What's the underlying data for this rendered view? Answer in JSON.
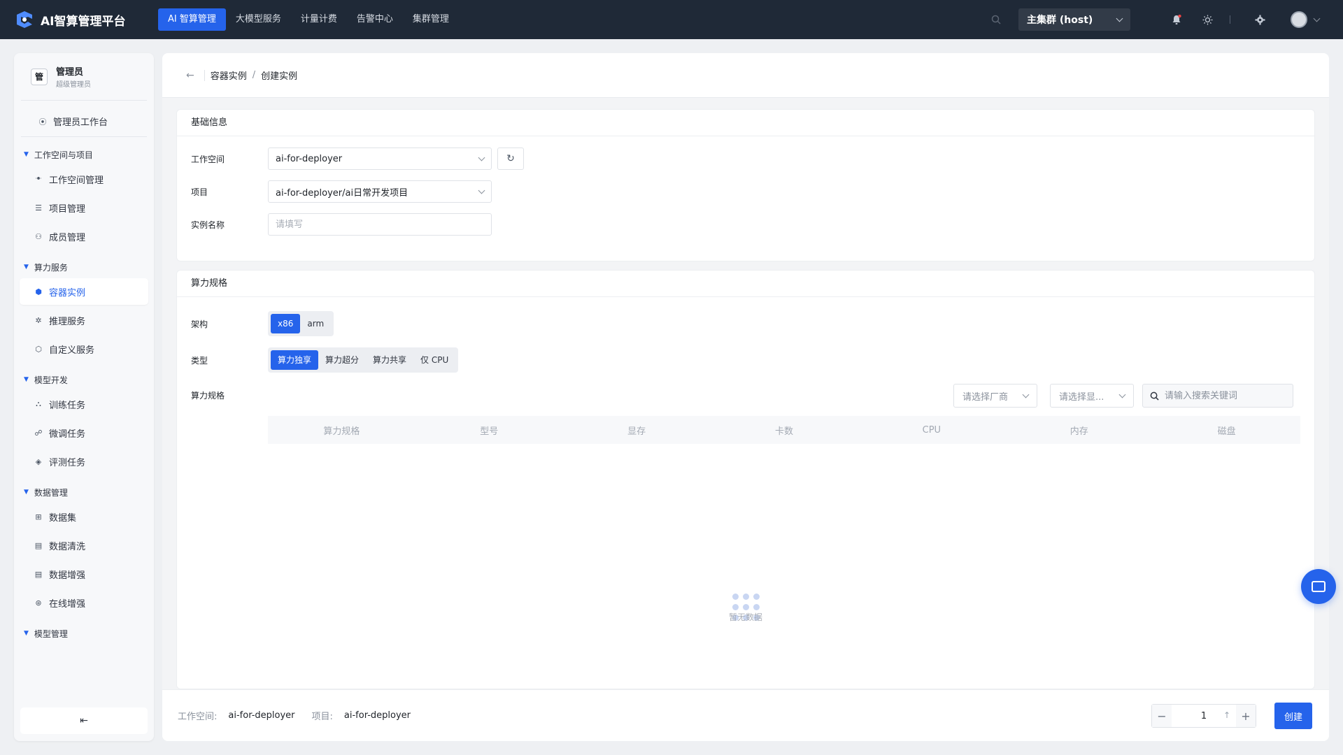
{
  "app": {
    "title": "AI智算管理平台",
    "accent": "#2563eb",
    "topbar_bg": "#1f2937"
  },
  "topnav": [
    {
      "label": "AI 智算管理",
      "active": true
    },
    {
      "label": "大模型服务",
      "active": false
    },
    {
      "label": "计量计费",
      "active": false
    },
    {
      "label": "告警中心",
      "active": false
    },
    {
      "label": "集群管理",
      "active": false
    }
  ],
  "topbar": {
    "cluster": "主集群 (host)",
    "icons": [
      "search-icon",
      "bell-icon",
      "sun-icon",
      "gear-icon",
      "avatar"
    ]
  },
  "sidebar": {
    "user": {
      "badge": "管",
      "name": "管理员",
      "role": "超级管理员"
    },
    "top_item": "管理员工作台",
    "groups": [
      {
        "label": "工作空间与项目",
        "items": [
          {
            "label": "工作空间管理",
            "icon": "users-icon",
            "active": false
          },
          {
            "label": "项目管理",
            "icon": "list-icon",
            "active": false
          },
          {
            "label": "成员管理",
            "icon": "org-icon",
            "active": false
          }
        ]
      },
      {
        "label": "算力服务",
        "items": [
          {
            "label": "容器实例",
            "icon": "cube-icon",
            "active": true
          },
          {
            "label": "推理服务",
            "icon": "gear-hex-icon",
            "active": false
          },
          {
            "label": "自定义服务",
            "icon": "hexagon-icon",
            "active": false
          }
        ]
      },
      {
        "label": "模型开发",
        "items": [
          {
            "label": "训练任务",
            "icon": "hierarchy-icon",
            "active": false
          },
          {
            "label": "微调任务",
            "icon": "nodes-icon",
            "active": false
          },
          {
            "label": "评测任务",
            "icon": "layers-icon",
            "active": false
          }
        ]
      },
      {
        "label": "数据管理",
        "items": [
          {
            "label": "数据集",
            "icon": "grid-icon",
            "active": false
          },
          {
            "label": "数据清洗",
            "icon": "table-icon",
            "active": false
          },
          {
            "label": "数据增强",
            "icon": "table-icon",
            "active": false
          },
          {
            "label": "在线增强",
            "icon": "globe-icon",
            "active": false
          }
        ]
      },
      {
        "label": "模型管理",
        "items": []
      }
    ],
    "collapse_glyph": "⇤"
  },
  "breadcrumb": {
    "parent": "容器实例",
    "current": "创建实例"
  },
  "basic": {
    "title": "基础信息",
    "workspace_label": "工作空间",
    "workspace_value": "ai-for-deployer",
    "project_label": "项目",
    "project_value": "ai-for-deployer/ai日常开发项目",
    "name_label": "实例名称",
    "name_placeholder": "请填写"
  },
  "spec": {
    "title": "算力规格",
    "arch_label": "架构",
    "arch_options": [
      {
        "label": "x86",
        "active": true
      },
      {
        "label": "arm",
        "active": false
      }
    ],
    "type_label": "类型",
    "type_options": [
      {
        "label": "算力独享",
        "active": true
      },
      {
        "label": "算力超分",
        "active": false
      },
      {
        "label": "算力共享",
        "active": false
      },
      {
        "label": "仅 CPU",
        "active": false
      }
    ],
    "spec_label": "算力规格",
    "vendor_placeholder": "请选择厂商",
    "gpu_placeholder": "请选择显...",
    "search_placeholder": "请输入搜索关键词",
    "columns": [
      "算力规格",
      "型号",
      "显存",
      "卡数",
      "CPU",
      "内存",
      "磁盘"
    ],
    "empty_text": "暂无数据"
  },
  "footer": {
    "workspace_label": "工作空间:",
    "workspace_value": "ai-for-deployer",
    "project_label": "项目:",
    "project_value": "ai-for-deployer",
    "quantity": "1",
    "create_label": "创建"
  }
}
